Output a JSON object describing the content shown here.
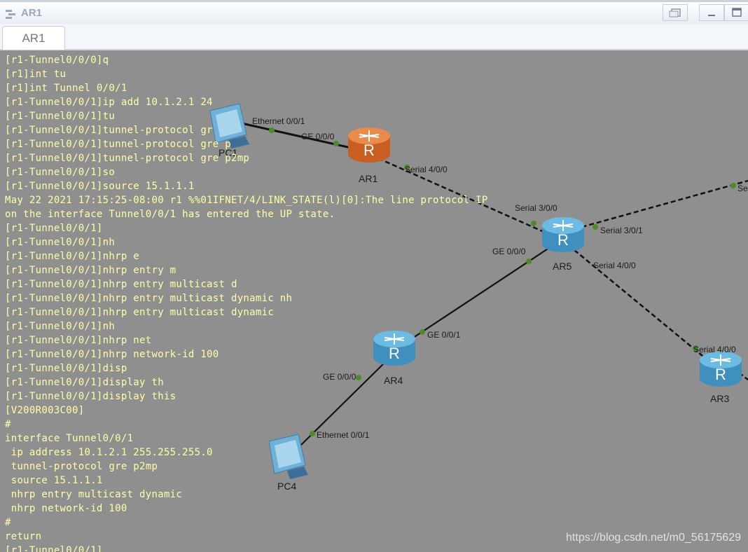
{
  "window": {
    "title": "AR1",
    "app_icon": "ensp-app-icon"
  },
  "tabs": [
    {
      "label": "AR1",
      "active": true
    }
  ],
  "console": {
    "text_color": "#ffffa8",
    "lines": [
      "[r1-Tunnel0/0/0]q",
      "[r1]int tu",
      "[r1]int Tunnel 0/0/1",
      "[r1-Tunnel0/0/1]ip add 10.1.2.1 24",
      "[r1-Tunnel0/0/1]tu",
      "[r1-Tunnel0/0/1]tunnel-protocol gr",
      "[r1-Tunnel0/0/1]tunnel-protocol gre p",
      "[r1-Tunnel0/0/1]tunnel-protocol gre p2mp",
      "[r1-Tunnel0/0/1]so",
      "[r1-Tunnel0/0/1]source 15.1.1.1",
      "May 22 2021 17:15:25-08:00 r1 %%01IFNET/4/LINK_STATE(l)[0]:The line protocol IP",
      "on the interface Tunnel0/0/1 has entered the UP state.",
      "[r1-Tunnel0/0/1]",
      "[r1-Tunnel0/0/1]nh",
      "[r1-Tunnel0/0/1]nhrp e",
      "[r1-Tunnel0/0/1]nhrp entry m",
      "[r1-Tunnel0/0/1]nhrp entry multicast d",
      "[r1-Tunnel0/0/1]nhrp entry multicast dynamic nh",
      "[r1-Tunnel0/0/1]nhrp entry multicast dynamic",
      "[r1-Tunnel0/0/1]nh",
      "[r1-Tunnel0/0/1]nhrp net",
      "[r1-Tunnel0/0/1]nhrp network-id 100",
      "[r1-Tunnel0/0/1]disp",
      "[r1-Tunnel0/0/1]display th",
      "[r1-Tunnel0/0/1]display this",
      "[V200R003C00]",
      "#",
      "interface Tunnel0/0/1",
      " ip address 10.1.2.1 255.255.255.0",
      " tunnel-protocol gre p2mp",
      " source 15.1.1.1",
      " nhrp entry multicast dynamic",
      " nhrp network-id 100",
      "#",
      "return",
      "[r1-Tunnel0/0/1]"
    ]
  },
  "topology": {
    "devices": [
      {
        "name": "PC1",
        "type": "pc"
      },
      {
        "name": "AR1",
        "type": "router",
        "color": "#e07b3a"
      },
      {
        "name": "AR5",
        "type": "router",
        "color": "#5aa9d6"
      },
      {
        "name": "AR4",
        "type": "router",
        "color": "#5aa9d6"
      },
      {
        "name": "AR3",
        "type": "router",
        "color": "#5aa9d6"
      },
      {
        "name": "PC4",
        "type": "pc"
      }
    ],
    "interface_labels": [
      "Ethernet 0/0/1",
      "GE 0/0/0",
      "Serial 4/0/0",
      "Serial 3/0/0",
      "Serial 3/0/1",
      "GE 0/0/0",
      "Serial 4/0/0",
      "GE 0/0/1",
      "GE 0/0/0",
      "Ethernet 0/0/1",
      "Serial 4/0/0",
      "Se"
    ],
    "port_dot_color": "#4c8a2a"
  },
  "watermark": "https://blog.csdn.net/m0_56175629"
}
